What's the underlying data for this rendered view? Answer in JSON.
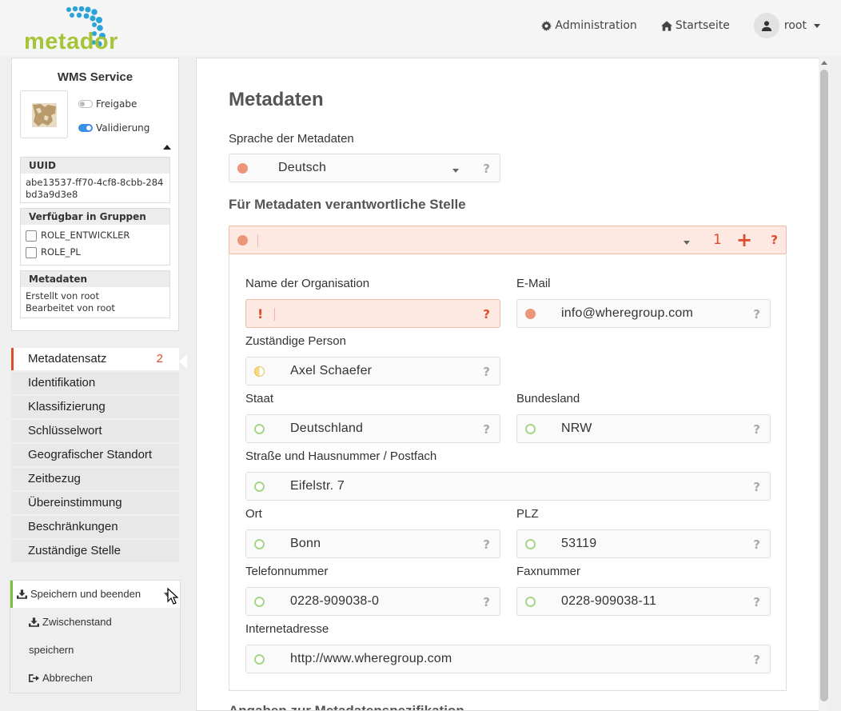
{
  "header": {
    "logo_text": "metador",
    "nav": [
      {
        "label": "Administration",
        "icon": "gear-icon"
      },
      {
        "label": "Startseite",
        "icon": "home-icon"
      }
    ],
    "user": "root"
  },
  "service_card": {
    "title": "WMS Service",
    "toggles": [
      {
        "label": "Freigabe",
        "on": false
      },
      {
        "label": "Validierung",
        "on": true
      }
    ],
    "uuid": {
      "heading": "UUID",
      "value": "abe13537-ff70-4cf8-8cbb-284bd3a9d3e8"
    },
    "groups": {
      "heading": "Verfügbar in Gruppen",
      "items": [
        "ROLE_ENTWICKLER",
        "ROLE_PL"
      ]
    },
    "metadata": {
      "heading": "Metadaten",
      "created": "Erstellt von root",
      "edited": "Bearbeitet von root"
    }
  },
  "sidebar": {
    "items": [
      {
        "label": "Metadatensatz",
        "count": "2",
        "active": true
      },
      {
        "label": "Identifikation"
      },
      {
        "label": "Klassifizierung"
      },
      {
        "label": "Schlüsselwort"
      },
      {
        "label": "Geografischer Standort"
      },
      {
        "label": "Zeitbezug"
      },
      {
        "label": "Übereinstimmung"
      },
      {
        "label": "Beschränkungen"
      },
      {
        "label": "Zuständige Stelle"
      }
    ]
  },
  "save_menu": {
    "primary": "Speichern und beenden",
    "items": [
      "Zwischenstand",
      "speichern",
      "Abbrechen"
    ]
  },
  "main": {
    "title": "Metadaten",
    "language": {
      "label": "Sprache der Metadaten",
      "value": "Deutsch",
      "help": "?"
    },
    "responsible": {
      "title": "Für Metadaten verantwortliche Stelle",
      "count": "1",
      "help": "?",
      "fields": {
        "org": {
          "label": "Name der Organisation",
          "value": "",
          "help": "?"
        },
        "email": {
          "label": "E-Mail",
          "value": "info@wheregroup.com",
          "help": "?"
        },
        "person": {
          "label": "Zuständige Person",
          "value": "Axel Schaefer",
          "help": "?"
        },
        "country": {
          "label": "Staat",
          "value": "Deutschland",
          "help": "?"
        },
        "state": {
          "label": "Bundesland",
          "value": "NRW",
          "help": "?"
        },
        "street": {
          "label": "Straße und Hausnummer / Postfach",
          "value": "Eifelstr. 7",
          "help": "?"
        },
        "city": {
          "label": "Ort",
          "value": "Bonn",
          "help": "?"
        },
        "zip": {
          "label": "PLZ",
          "value": "53119",
          "help": "?"
        },
        "phone": {
          "label": "Telefonnummer",
          "value": "0228-909038-0",
          "help": "?"
        },
        "fax": {
          "label": "Faxnummer",
          "value": "0228-909038-11",
          "help": "?"
        },
        "web": {
          "label": "Internetadresse",
          "value": "http://www.wheregroup.com",
          "help": "?"
        }
      }
    },
    "next_section": "Angaben zur Metadatenspezifikation"
  },
  "colors": {
    "accent_red": "#e04b2b",
    "logo_green": "#a6c437",
    "logo_blue": "#2ba3d6"
  }
}
